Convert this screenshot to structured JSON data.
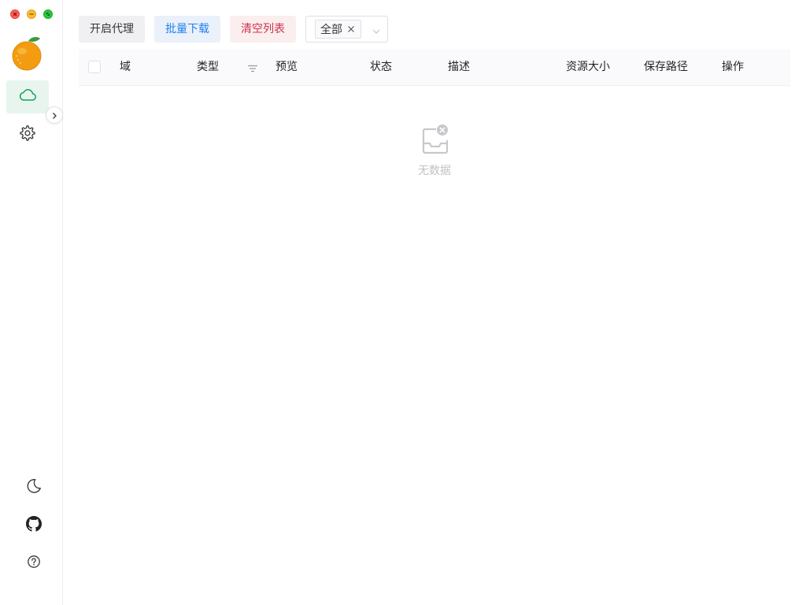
{
  "window": {
    "controls": [
      "close-icon",
      "minimize-icon",
      "maximize-icon"
    ]
  },
  "sidebar": {
    "logo_icon": "orange-logo-icon",
    "nav": [
      {
        "icon": "cloud-icon",
        "active": true
      },
      {
        "icon": "gear-icon",
        "active": false
      }
    ],
    "bottom": [
      "moon-icon",
      "github-icon",
      "help-icon"
    ]
  },
  "toolbar": {
    "proxy_label": "开启代理",
    "download_label": "批量下载",
    "clear_label": "清空列表",
    "filter_tag": "全部"
  },
  "table": {
    "columns": [
      "域",
      "类型",
      "预览",
      "状态",
      "描述",
      "资源大小",
      "保存路径",
      "操作"
    ],
    "rows": [],
    "empty_text": "无数据"
  },
  "colors": {
    "accent": "#18a058",
    "active_bg": "#e7f5ee",
    "info": "#2080f0",
    "error": "#d03050"
  }
}
